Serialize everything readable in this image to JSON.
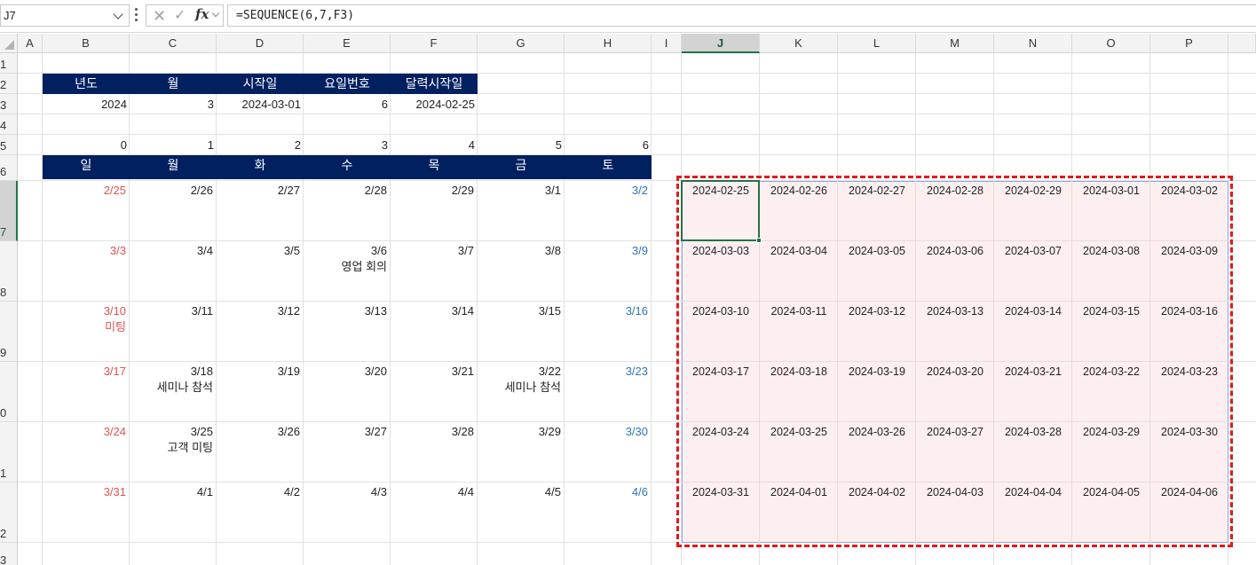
{
  "formula_bar": {
    "name_box": "J7",
    "formula": "=SEQUENCE(6,7,F3)",
    "cancel_icon": "✕",
    "enter_icon": "✓",
    "fx_label": "fx"
  },
  "columns": [
    "A",
    "B",
    "C",
    "D",
    "E",
    "F",
    "G",
    "H",
    "I",
    "J",
    "K",
    "L",
    "M",
    "N",
    "O",
    "P"
  ],
  "selected_column": "J",
  "rows": [
    "1",
    "2",
    "3",
    "4",
    "5",
    "6",
    "7",
    "8",
    "9",
    "0",
    "1",
    "2",
    "3"
  ],
  "selected_row_index": 6,
  "info_table": {
    "headers": [
      "년도",
      "월",
      "시작일",
      "요일번호",
      "달력시작일"
    ],
    "values": [
      "2024",
      "3",
      "2024-03-01",
      "6",
      "2024-02-25"
    ]
  },
  "weekday_index": [
    "0",
    "1",
    "2",
    "3",
    "4",
    "5",
    "6"
  ],
  "weekday_headers": [
    "일",
    "월",
    "화",
    "수",
    "목",
    "금",
    "토"
  ],
  "calendar": [
    [
      {
        "d": "2/25",
        "n": ""
      },
      {
        "d": "2/26",
        "n": ""
      },
      {
        "d": "2/27",
        "n": ""
      },
      {
        "d": "2/28",
        "n": ""
      },
      {
        "d": "2/29",
        "n": ""
      },
      {
        "d": "3/1",
        "n": ""
      },
      {
        "d": "3/2",
        "n": ""
      }
    ],
    [
      {
        "d": "3/3",
        "n": ""
      },
      {
        "d": "3/4",
        "n": ""
      },
      {
        "d": "3/5",
        "n": ""
      },
      {
        "d": "3/6",
        "n": "영업 회의"
      },
      {
        "d": "3/7",
        "n": ""
      },
      {
        "d": "3/8",
        "n": ""
      },
      {
        "d": "3/9",
        "n": ""
      }
    ],
    [
      {
        "d": "3/10",
        "n": "미팅"
      },
      {
        "d": "3/11",
        "n": ""
      },
      {
        "d": "3/12",
        "n": ""
      },
      {
        "d": "3/13",
        "n": ""
      },
      {
        "d": "3/14",
        "n": ""
      },
      {
        "d": "3/15",
        "n": ""
      },
      {
        "d": "3/16",
        "n": ""
      }
    ],
    [
      {
        "d": "3/17",
        "n": ""
      },
      {
        "d": "3/18",
        "n": "세미나 참석"
      },
      {
        "d": "3/19",
        "n": ""
      },
      {
        "d": "3/20",
        "n": ""
      },
      {
        "d": "3/21",
        "n": ""
      },
      {
        "d": "3/22",
        "n": "세미나 참석"
      },
      {
        "d": "3/23",
        "n": ""
      }
    ],
    [
      {
        "d": "3/24",
        "n": ""
      },
      {
        "d": "3/25",
        "n": "고객 미팅"
      },
      {
        "d": "3/26",
        "n": ""
      },
      {
        "d": "3/27",
        "n": ""
      },
      {
        "d": "3/28",
        "n": ""
      },
      {
        "d": "3/29",
        "n": ""
      },
      {
        "d": "3/30",
        "n": ""
      }
    ],
    [
      {
        "d": "3/31",
        "n": ""
      },
      {
        "d": "4/1",
        "n": ""
      },
      {
        "d": "4/2",
        "n": ""
      },
      {
        "d": "4/3",
        "n": ""
      },
      {
        "d": "4/4",
        "n": ""
      },
      {
        "d": "4/5",
        "n": ""
      },
      {
        "d": "4/6",
        "n": ""
      }
    ]
  ],
  "sequence": [
    [
      "2024-02-25",
      "2024-02-26",
      "2024-02-27",
      "2024-02-28",
      "2024-02-29",
      "2024-03-01",
      "2024-03-02"
    ],
    [
      "2024-03-03",
      "2024-03-04",
      "2024-03-05",
      "2024-03-06",
      "2024-03-07",
      "2024-03-08",
      "2024-03-09"
    ],
    [
      "2024-03-10",
      "2024-03-11",
      "2024-03-12",
      "2024-03-13",
      "2024-03-14",
      "2024-03-15",
      "2024-03-16"
    ],
    [
      "2024-03-17",
      "2024-03-18",
      "2024-03-19",
      "2024-03-20",
      "2024-03-21",
      "2024-03-22",
      "2024-03-23"
    ],
    [
      "2024-03-24",
      "2024-03-25",
      "2024-03-26",
      "2024-03-27",
      "2024-03-28",
      "2024-03-29",
      "2024-03-30"
    ],
    [
      "2024-03-31",
      "2024-04-01",
      "2024-04-02",
      "2024-04-03",
      "2024-04-04",
      "2024-04-05",
      "2024-04-06"
    ]
  ],
  "colors": {
    "header_fill": "#002060",
    "sunday": "#e05252",
    "saturday": "#2e75b6",
    "spill_fill": "#fdeff0",
    "highlight_dash": "#e41a1a",
    "selection": "#217346"
  }
}
